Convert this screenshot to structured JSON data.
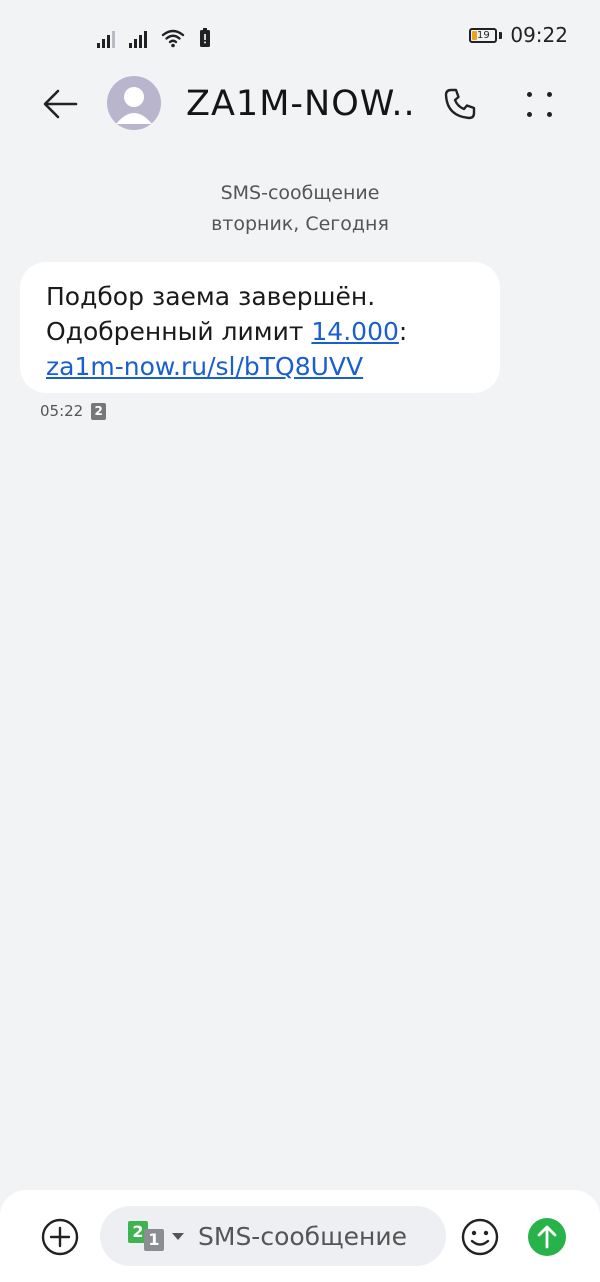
{
  "status_bar": {
    "time": "09:22",
    "battery_level": "19",
    "icons": [
      "signal-sim1-icon",
      "signal-sim2-icon",
      "wifi-icon",
      "battery-saver-icon"
    ]
  },
  "header": {
    "contact_name": "ZA1M-NOW....",
    "icons": [
      "back-arrow-icon",
      "avatar-placeholder-icon",
      "phone-icon",
      "more-options-icon"
    ]
  },
  "thread": {
    "channel_label": "SMS-сообщение",
    "date_label": "вторник, Сегодня",
    "messages": [
      {
        "line1": "Подбор заема завершён.",
        "line2_prefix": "Одобренный лимит ",
        "amount_link": "14.000",
        "line2_suffix": ":",
        "url_link": "za1m-now.ru/sl/bTQ8UVV",
        "time": "05:22",
        "sim": "2"
      }
    ]
  },
  "composer": {
    "placeholder": "SMS-сообщение",
    "sim_primary": "2",
    "sim_secondary": "1",
    "icons": [
      "add-attachment-icon",
      "emoji-icon",
      "send-icon"
    ],
    "send_color": "#27b24a"
  }
}
